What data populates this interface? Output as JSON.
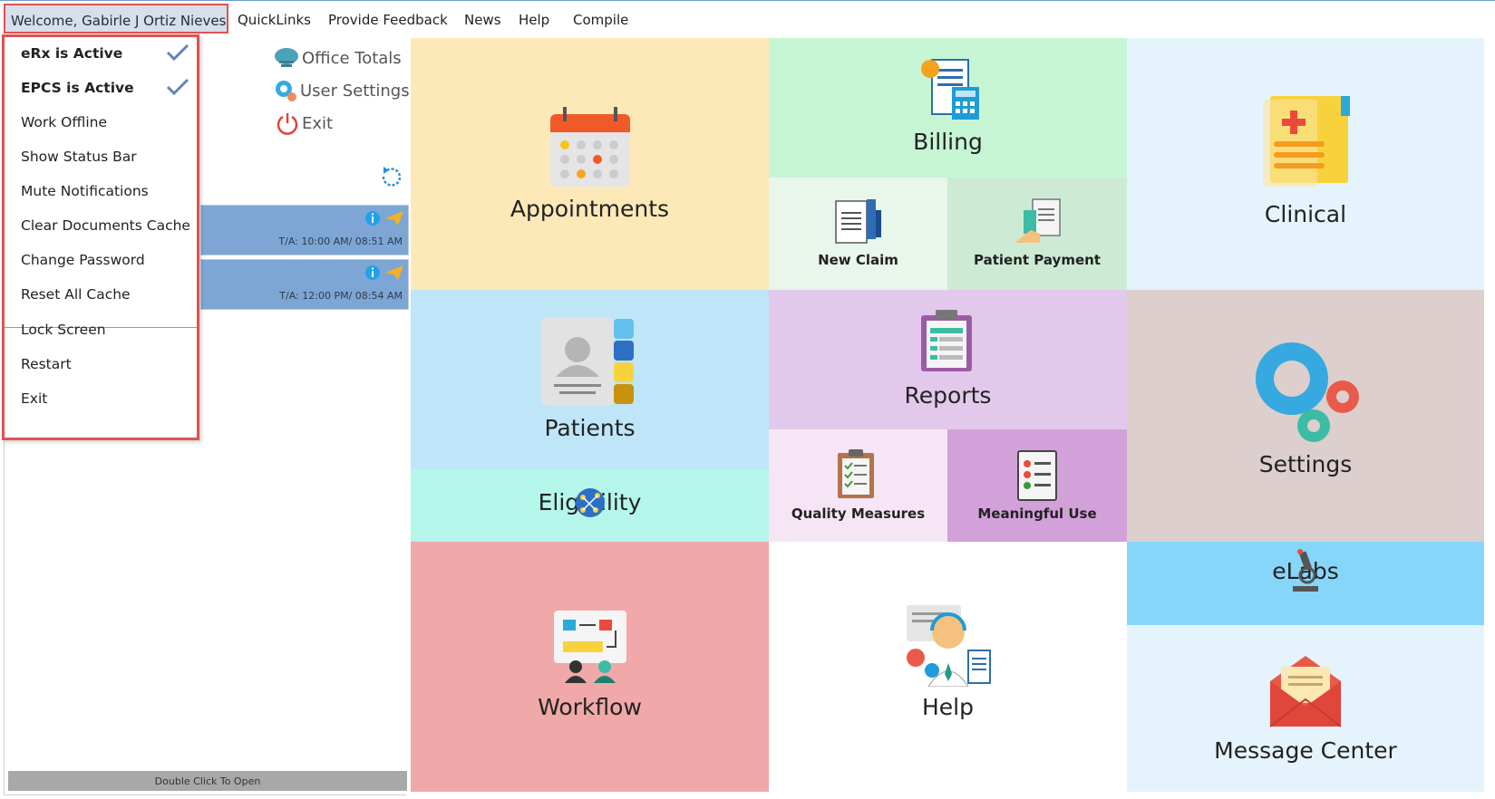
{
  "menubar": {
    "welcome": "Welcome, Gabirle J Ortiz Nieves",
    "items": [
      "QuickLinks",
      "Provide Feedback",
      "News",
      "Help",
      "Compile"
    ]
  },
  "dropdown": {
    "items": [
      {
        "label": "eRx is Active",
        "checked": true
      },
      {
        "label": "EPCS is Active",
        "checked": true
      },
      {
        "label": "Work Offline"
      },
      {
        "label": "Show Status Bar"
      },
      {
        "label": "Mute Notifications"
      },
      {
        "label": "Clear Documents Cache"
      },
      {
        "label": "Change Password"
      },
      {
        "label": "Reset All Cache"
      },
      {
        "label": "Lock Screen"
      },
      {
        "label": "Restart"
      },
      {
        "label": "Exit"
      }
    ]
  },
  "left": {
    "quicklinks": {
      "office_totals": "Office Totals",
      "user_settings": "User Settings",
      "exit": "Exit"
    },
    "appointments": [
      {
        "time": "T/A: 10:00 AM/ 08:51 AM"
      },
      {
        "time": "T/A: 12:00 PM/ 08:54 AM"
      }
    ],
    "double_click": "Double Click To Open"
  },
  "tiles": {
    "appointments": "Appointments",
    "billing": "Billing",
    "new_claim": "New Claim",
    "patient_payment": "Patient Payment",
    "clinical": "Clinical",
    "patients": "Patients",
    "eligibility": "Eligibility",
    "reports": "Reports",
    "quality_measures": "Quality Measures",
    "meaningful_use": "Meaningful Use",
    "settings": "Settings",
    "workflow": "Workflow",
    "help": "Help",
    "elabs": "eLabs",
    "message_center": "Message Center"
  },
  "colors": {
    "appointments": "#fde9b8",
    "billing": "#c6f5d4",
    "new_claim": "#e8f6ec",
    "patient_payment": "#cdebd4",
    "clinical": "#e5f3fc",
    "patients": "#bfe5f8",
    "eligibility": "#b5f6ea",
    "reports": "#e2c9eb",
    "quality_measures": "#f6e6f5",
    "meaningful_use": "#d3a1da",
    "settings": "#dccfcd",
    "workflow": "#f0a8a8",
    "help": "#ffffff",
    "elabs": "#86d6f9",
    "message_center": "#e5f3fc",
    "highlight_border": "#e05252"
  }
}
